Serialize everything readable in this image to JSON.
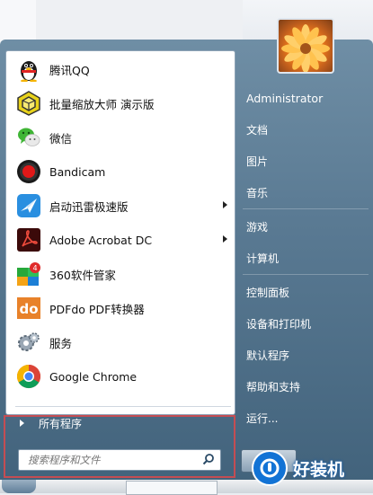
{
  "left_apps": [
    {
      "label": "腾讯QQ",
      "icon": "qq-penguin-icon",
      "arrow": false
    },
    {
      "label": "批量缩放大师 演示版",
      "icon": "batch-resize-icon",
      "arrow": false
    },
    {
      "label": "微信",
      "icon": "wechat-icon",
      "arrow": false
    },
    {
      "label": "Bandicam",
      "icon": "bandicam-record-icon",
      "arrow": false
    },
    {
      "label": "启动迅雷极速版",
      "icon": "xunlei-bird-icon",
      "arrow": true
    },
    {
      "label": "Adobe Acrobat DC",
      "icon": "acrobat-icon",
      "arrow": true
    },
    {
      "label": "360软件管家",
      "icon": "360-manager-icon",
      "arrow": false
    },
    {
      "label": "PDFdo PDF转换器",
      "icon": "pdfdo-icon",
      "arrow": false
    },
    {
      "label": "服务",
      "icon": "services-gear-icon",
      "arrow": false
    },
    {
      "label": "Google Chrome",
      "icon": "chrome-icon",
      "arrow": false
    }
  ],
  "all_programs_label": "所有程序",
  "search": {
    "placeholder": "搜索程序和文件"
  },
  "right_items": {
    "user": "Administrator",
    "documents": "文档",
    "pictures": "图片",
    "music": "音乐",
    "games": "游戏",
    "computer": "计算机",
    "control_panel": "控制面板",
    "devices_printers": "设备和打印机",
    "default_programs": "默认程序",
    "help_support": "帮助和支持",
    "run": "运行..."
  },
  "watermark": {
    "text": "好装机"
  },
  "colors": {
    "highlight": "#c44d53",
    "pane_glass": "#5a7a93",
    "watermark_blue": "#1273d5"
  }
}
